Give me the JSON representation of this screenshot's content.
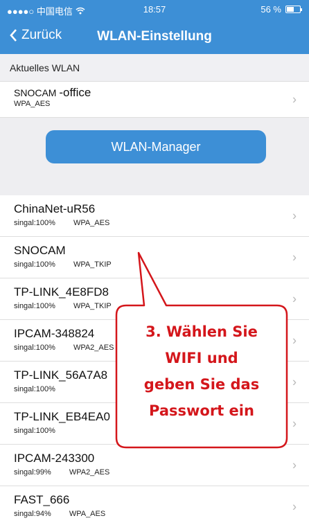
{
  "status_bar": {
    "carrier": "●●●●○ 中国电信",
    "time": "18:57",
    "battery_text": "56 %",
    "battery_level": 0.56
  },
  "nav": {
    "back_label": "Zurück",
    "title": "WLAN-Einstellung"
  },
  "current_section": {
    "header": "Aktuelles WLAN",
    "network": {
      "name_prefix": "SNOCAM ",
      "name_suffix": "-office",
      "security": "WPA_AES"
    }
  },
  "manager_button": {
    "label": "WLAN-Manager"
  },
  "networks": [
    {
      "name": "ChinaNet-uR56",
      "signal": "singal:100%",
      "security": "WPA_AES"
    },
    {
      "name": "SNOCAM",
      "signal": "singal:100%",
      "security": "WPA_TKIP"
    },
    {
      "name": "TP-LINK_4E8FD8",
      "signal": "singal:100%",
      "security": "WPA_TKIP"
    },
    {
      "name": "IPCAM-348824",
      "signal": "singal:100%",
      "security": "WPA2_AES"
    },
    {
      "name": "TP-LINK_56A7A8",
      "signal": "singal:100%",
      "security": ""
    },
    {
      "name": "TP-LINK_EB4EA0",
      "signal": "singal:100%",
      "security": ""
    },
    {
      "name": "IPCAM-243300",
      "signal": "singal:99%",
      "security": "WPA2_AES"
    },
    {
      "name": "FAST_666",
      "signal": "singal:94%",
      "security": "WPA_AES"
    }
  ],
  "annotation": {
    "lines": [
      "3. Wählen Sie",
      "WIFI und",
      "geben Sie das",
      "Passwort ein"
    ],
    "color": "#d4161b"
  },
  "colors": {
    "brand_blue": "#3d8fd6",
    "chevron": "#b8b8b8"
  },
  "icons": {
    "wifi": "wifi-icon",
    "back": "chevron-left-icon",
    "row_chevron": "chevron-right-icon",
    "battery": "battery-icon"
  }
}
